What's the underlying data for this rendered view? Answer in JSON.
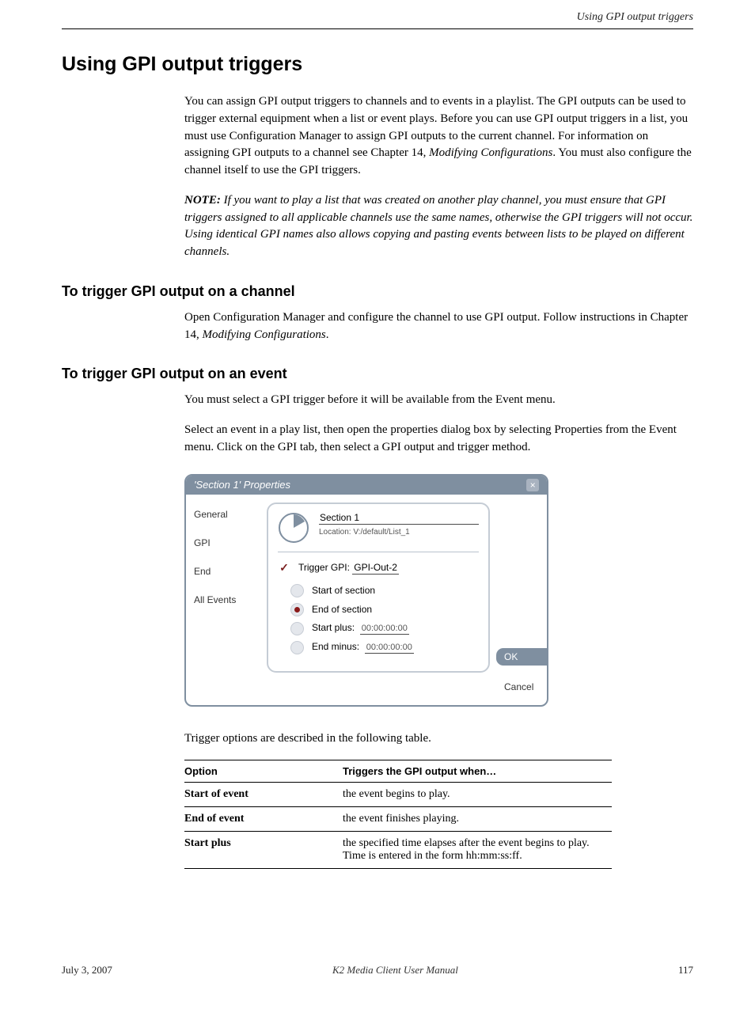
{
  "header": {
    "running_title": "Using GPI output triggers"
  },
  "section": {
    "h2": "Using GPI output triggers",
    "intro_para_1": "You can assign GPI output triggers to channels and to events in a playlist. The GPI outputs can be used to trigger external equipment when a list or event plays. Before you can use GPI output triggers in a list, you must use Configuration Manager to assign GPI outputs to the current channel. For information on assigning GPI outputs to a channel see Chapter 14,",
    "intro_para_1_italic": "Modifying Configurations",
    "intro_para_after_italic": ". You must also configure the channel itself to use the GPI triggers.",
    "note_label": "NOTE:",
    "note_text": " If you want to play a list that was created on another play channel, you must ensure that GPI triggers assigned to all applicable channels use the same names, otherwise the GPI triggers will not occur. Using identical GPI names also allows copying and pasting events between lists to be played on different channels.",
    "h3_1": "To trigger GPI output on a channel",
    "body_1": "Open Configuration Manager and configure the channel to use GPI output. Follow instructions in Chapter 14,",
    "body_1_italic": "Modifying Configurations",
    "body_1_after": ".",
    "h3_2": "To trigger GPI output on an event",
    "body_2a": "You must select a GPI trigger before it will be available from the Event menu.",
    "body_2b": "Select an event in a play list, then open the properties dialog box by selecting Properties from the Event menu. Click on the GPI tab, then select a GPI output and trigger method.",
    "options_intro": "Trigger options are described in the following table."
  },
  "dialog": {
    "title": "'Section 1' Properties",
    "tabs": {
      "general": "General",
      "gpi": "GPI",
      "end": "End",
      "allevents": "All Events"
    },
    "section_name": "Section 1",
    "location_label": "Location:",
    "location_value": "V:/default/List_1",
    "trigger_label": "Trigger GPI:",
    "trigger_value": "GPI-Out-2",
    "start_of_section": "Start of section",
    "end_of_section": "End of section",
    "start_plus_label": "Start plus:",
    "start_plus_value": "00:00:00:00",
    "end_minus_label": "End minus:",
    "end_minus_value": "00:00:00:00",
    "ok": "OK",
    "cancel": "Cancel"
  },
  "table": {
    "col1": "Option",
    "col2": "Triggers the GPI output when…",
    "rows": [
      {
        "opt": "Start of event",
        "desc": "the event begins to play."
      },
      {
        "opt": "End of event",
        "desc": "the event finishes playing."
      },
      {
        "opt": "Start plus",
        "desc": "the specified time elapses after the event begins to play. Time is entered in the form hh:mm:ss:ff."
      }
    ]
  },
  "footer": {
    "date": "July 3, 2007",
    "center": "K2 Media Client User Manual",
    "page": "117"
  }
}
